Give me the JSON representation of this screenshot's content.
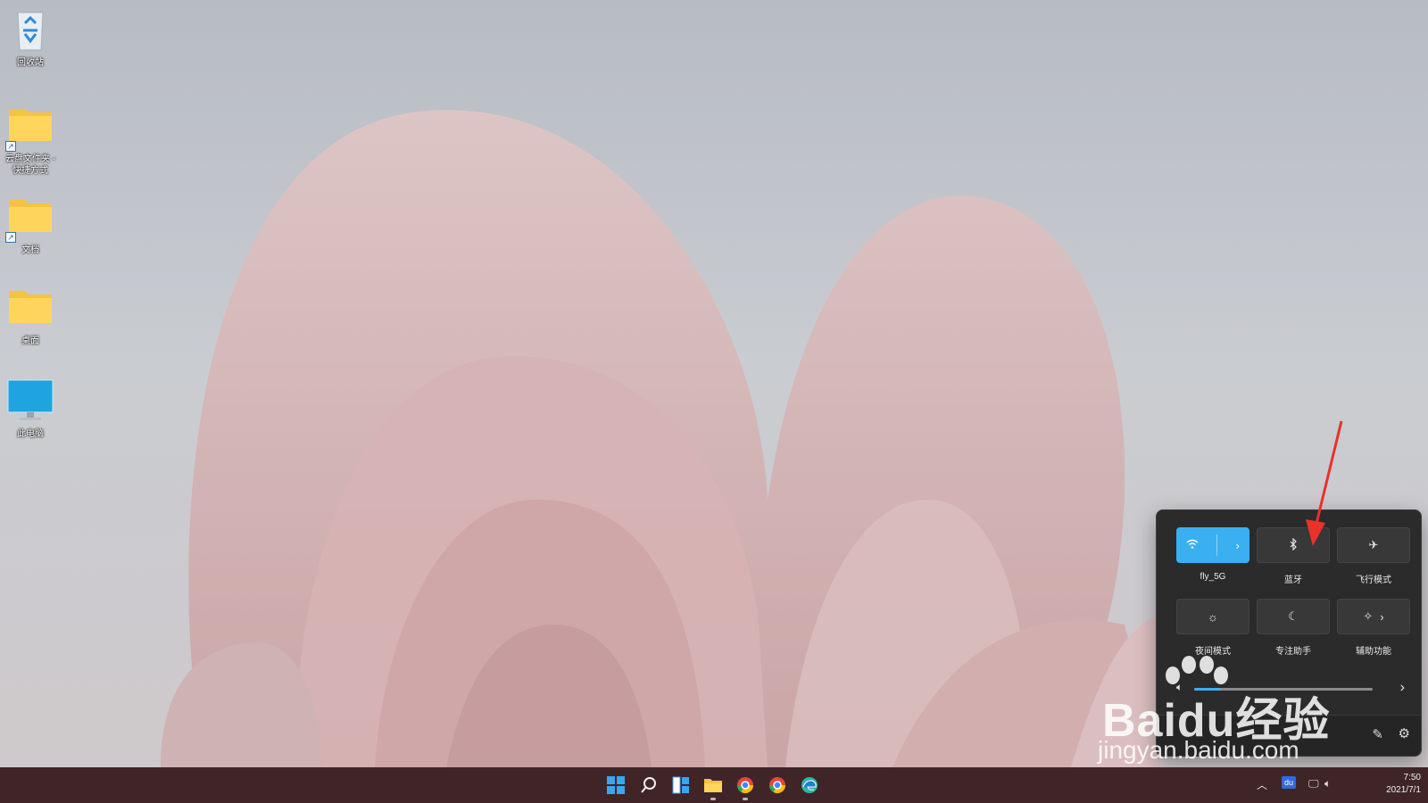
{
  "desktop": {
    "icons": [
      {
        "label": "回收站",
        "icon": "recycle-bin-icon"
      },
      {
        "label": "云盘文件夹 - 快捷方式",
        "icon": "folder-shortcut-icon"
      },
      {
        "label": "文档",
        "icon": "folder-shortcut-icon"
      },
      {
        "label": "桌面",
        "icon": "folder-icon"
      },
      {
        "label": "此电脑",
        "icon": "computer-icon"
      }
    ]
  },
  "quick_settings": {
    "tiles": [
      {
        "label": "fly_5G",
        "icon": "wifi-icon",
        "active": true
      },
      {
        "label": "蓝牙",
        "icon": "bluetooth-icon",
        "active": false
      },
      {
        "label": "飞行模式",
        "icon": "airplane-icon",
        "active": false
      },
      {
        "label": "夜间模式",
        "icon": "brightness-icon",
        "active": false
      },
      {
        "label": "专注助手",
        "icon": "moon-icon",
        "active": false
      },
      {
        "label": "辅助功能",
        "icon": "accessibility-icon",
        "active": false
      }
    ],
    "volume_level": 0.15,
    "accent_color": "#3ab0f0"
  },
  "watermark": {
    "brand": "Baidu经验",
    "url": "jingyan.baidu.com"
  },
  "taskbar": {
    "apps": [
      "start-icon",
      "search-icon",
      "widgets-icon",
      "file-explorer-icon",
      "chrome-icon",
      "chrome-icon",
      "edge-icon"
    ],
    "clock_time": "7:50",
    "clock_date": "2021/7/1",
    "tray_badge": "du",
    "background_color": "#3f2527"
  }
}
